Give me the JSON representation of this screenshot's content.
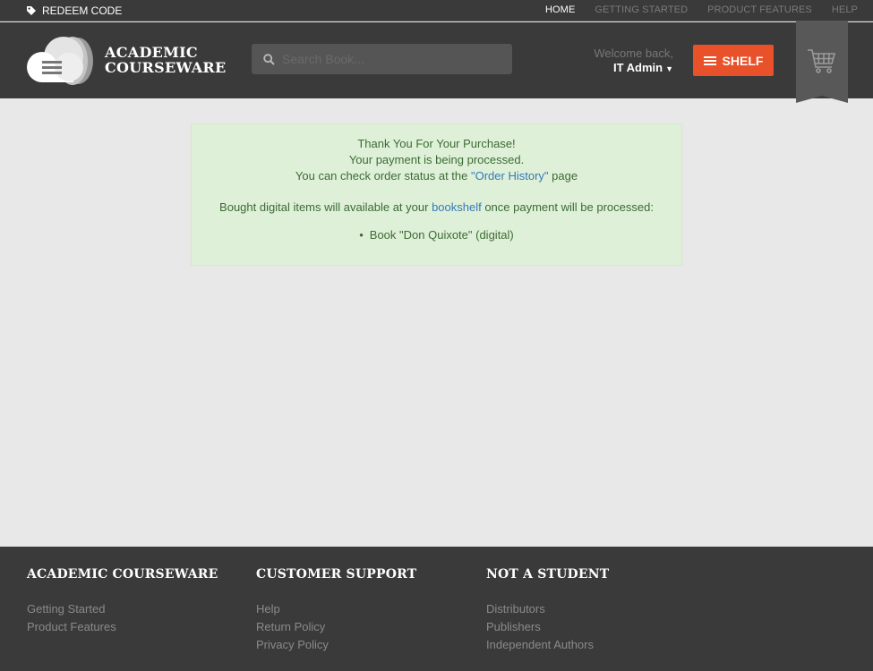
{
  "topbar": {
    "redeem_label": "REDEEM CODE",
    "nav": [
      "HOME",
      "GETTING STARTED",
      "PRODUCT FEATURES",
      "HELP"
    ]
  },
  "header": {
    "logo_line1": "ACADEMIC",
    "logo_line2": "COURSEWARE",
    "search_placeholder": "Search Book...",
    "welcome": "Welcome back,",
    "user": "IT Admin",
    "shelf_label": "SHELF"
  },
  "alert": {
    "line1": "Thank You For Your Purchase!",
    "line2": "Your payment is being processed.",
    "line3_pre": "You can check order status at the ",
    "line3_link": "\"Order History\"",
    "line3_post": " page",
    "line4_pre": "Bought digital items will available at your ",
    "line4_link": "bookshelf",
    "line4_post": " once payment will be processed:",
    "items": [
      "Book \"Don Quixote\" (digital)"
    ]
  },
  "footer": {
    "col1": {
      "title": "ACADEMIC COURSEWARE",
      "links": [
        "Getting Started",
        "Product Features"
      ]
    },
    "col2": {
      "title": "CUSTOMER SUPPORT",
      "links": [
        "Help",
        "Return Policy",
        "Privacy Policy"
      ]
    },
    "col3": {
      "title": "NOT A STUDENT",
      "links": [
        "Distributors",
        "Publishers",
        "Independent Authors"
      ]
    }
  },
  "colors": {
    "accent": "#e8512a",
    "header_bg": "#3a3a3a",
    "alert_bg": "#dff0d8",
    "link": "#3479b7"
  }
}
